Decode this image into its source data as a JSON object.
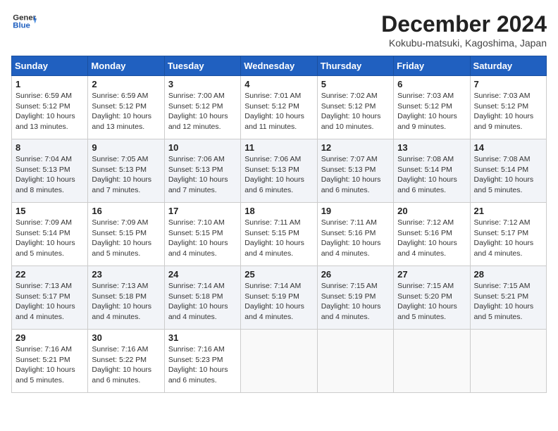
{
  "header": {
    "logo_line1": "General",
    "logo_line2": "Blue",
    "month_title": "December 2024",
    "location": "Kokubu-matsuki, Kagoshima, Japan"
  },
  "weekdays": [
    "Sunday",
    "Monday",
    "Tuesday",
    "Wednesday",
    "Thursday",
    "Friday",
    "Saturday"
  ],
  "weeks": [
    [
      {
        "day": "1",
        "info": "Sunrise: 6:59 AM\nSunset: 5:12 PM\nDaylight: 10 hours\nand 13 minutes."
      },
      {
        "day": "2",
        "info": "Sunrise: 6:59 AM\nSunset: 5:12 PM\nDaylight: 10 hours\nand 13 minutes."
      },
      {
        "day": "3",
        "info": "Sunrise: 7:00 AM\nSunset: 5:12 PM\nDaylight: 10 hours\nand 12 minutes."
      },
      {
        "day": "4",
        "info": "Sunrise: 7:01 AM\nSunset: 5:12 PM\nDaylight: 10 hours\nand 11 minutes."
      },
      {
        "day": "5",
        "info": "Sunrise: 7:02 AM\nSunset: 5:12 PM\nDaylight: 10 hours\nand 10 minutes."
      },
      {
        "day": "6",
        "info": "Sunrise: 7:03 AM\nSunset: 5:12 PM\nDaylight: 10 hours\nand 9 minutes."
      },
      {
        "day": "7",
        "info": "Sunrise: 7:03 AM\nSunset: 5:12 PM\nDaylight: 10 hours\nand 9 minutes."
      }
    ],
    [
      {
        "day": "8",
        "info": "Sunrise: 7:04 AM\nSunset: 5:13 PM\nDaylight: 10 hours\nand 8 minutes."
      },
      {
        "day": "9",
        "info": "Sunrise: 7:05 AM\nSunset: 5:13 PM\nDaylight: 10 hours\nand 7 minutes."
      },
      {
        "day": "10",
        "info": "Sunrise: 7:06 AM\nSunset: 5:13 PM\nDaylight: 10 hours\nand 7 minutes."
      },
      {
        "day": "11",
        "info": "Sunrise: 7:06 AM\nSunset: 5:13 PM\nDaylight: 10 hours\nand 6 minutes."
      },
      {
        "day": "12",
        "info": "Sunrise: 7:07 AM\nSunset: 5:13 PM\nDaylight: 10 hours\nand 6 minutes."
      },
      {
        "day": "13",
        "info": "Sunrise: 7:08 AM\nSunset: 5:14 PM\nDaylight: 10 hours\nand 6 minutes."
      },
      {
        "day": "14",
        "info": "Sunrise: 7:08 AM\nSunset: 5:14 PM\nDaylight: 10 hours\nand 5 minutes."
      }
    ],
    [
      {
        "day": "15",
        "info": "Sunrise: 7:09 AM\nSunset: 5:14 PM\nDaylight: 10 hours\nand 5 minutes."
      },
      {
        "day": "16",
        "info": "Sunrise: 7:09 AM\nSunset: 5:15 PM\nDaylight: 10 hours\nand 5 minutes."
      },
      {
        "day": "17",
        "info": "Sunrise: 7:10 AM\nSunset: 5:15 PM\nDaylight: 10 hours\nand 4 minutes."
      },
      {
        "day": "18",
        "info": "Sunrise: 7:11 AM\nSunset: 5:15 PM\nDaylight: 10 hours\nand 4 minutes."
      },
      {
        "day": "19",
        "info": "Sunrise: 7:11 AM\nSunset: 5:16 PM\nDaylight: 10 hours\nand 4 minutes."
      },
      {
        "day": "20",
        "info": "Sunrise: 7:12 AM\nSunset: 5:16 PM\nDaylight: 10 hours\nand 4 minutes."
      },
      {
        "day": "21",
        "info": "Sunrise: 7:12 AM\nSunset: 5:17 PM\nDaylight: 10 hours\nand 4 minutes."
      }
    ],
    [
      {
        "day": "22",
        "info": "Sunrise: 7:13 AM\nSunset: 5:17 PM\nDaylight: 10 hours\nand 4 minutes."
      },
      {
        "day": "23",
        "info": "Sunrise: 7:13 AM\nSunset: 5:18 PM\nDaylight: 10 hours\nand 4 minutes."
      },
      {
        "day": "24",
        "info": "Sunrise: 7:14 AM\nSunset: 5:18 PM\nDaylight: 10 hours\nand 4 minutes."
      },
      {
        "day": "25",
        "info": "Sunrise: 7:14 AM\nSunset: 5:19 PM\nDaylight: 10 hours\nand 4 minutes."
      },
      {
        "day": "26",
        "info": "Sunrise: 7:15 AM\nSunset: 5:19 PM\nDaylight: 10 hours\nand 4 minutes."
      },
      {
        "day": "27",
        "info": "Sunrise: 7:15 AM\nSunset: 5:20 PM\nDaylight: 10 hours\nand 5 minutes."
      },
      {
        "day": "28",
        "info": "Sunrise: 7:15 AM\nSunset: 5:21 PM\nDaylight: 10 hours\nand 5 minutes."
      }
    ],
    [
      {
        "day": "29",
        "info": "Sunrise: 7:16 AM\nSunset: 5:21 PM\nDaylight: 10 hours\nand 5 minutes."
      },
      {
        "day": "30",
        "info": "Sunrise: 7:16 AM\nSunset: 5:22 PM\nDaylight: 10 hours\nand 6 minutes."
      },
      {
        "day": "31",
        "info": "Sunrise: 7:16 AM\nSunset: 5:23 PM\nDaylight: 10 hours\nand 6 minutes."
      },
      {
        "day": "",
        "info": ""
      },
      {
        "day": "",
        "info": ""
      },
      {
        "day": "",
        "info": ""
      },
      {
        "day": "",
        "info": ""
      }
    ]
  ]
}
